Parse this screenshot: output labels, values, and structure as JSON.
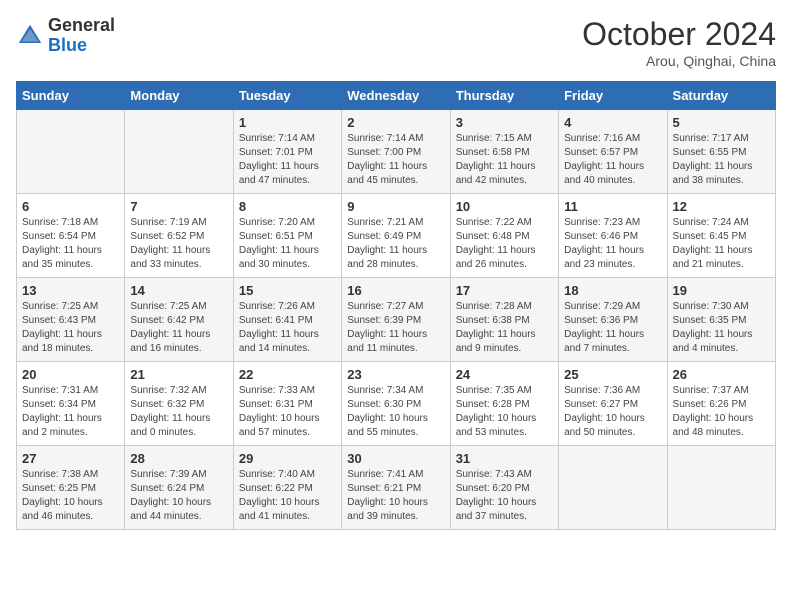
{
  "logo": {
    "general": "General",
    "blue": "Blue"
  },
  "header": {
    "month": "October 2024",
    "location": "Arou, Qinghai, China"
  },
  "days_of_week": [
    "Sunday",
    "Monday",
    "Tuesday",
    "Wednesday",
    "Thursday",
    "Friday",
    "Saturday"
  ],
  "weeks": [
    [
      {
        "day": "",
        "info": ""
      },
      {
        "day": "",
        "info": ""
      },
      {
        "day": "1",
        "info": "Sunrise: 7:14 AM\nSunset: 7:01 PM\nDaylight: 11 hours and 47 minutes."
      },
      {
        "day": "2",
        "info": "Sunrise: 7:14 AM\nSunset: 7:00 PM\nDaylight: 11 hours and 45 minutes."
      },
      {
        "day": "3",
        "info": "Sunrise: 7:15 AM\nSunset: 6:58 PM\nDaylight: 11 hours and 42 minutes."
      },
      {
        "day": "4",
        "info": "Sunrise: 7:16 AM\nSunset: 6:57 PM\nDaylight: 11 hours and 40 minutes."
      },
      {
        "day": "5",
        "info": "Sunrise: 7:17 AM\nSunset: 6:55 PM\nDaylight: 11 hours and 38 minutes."
      }
    ],
    [
      {
        "day": "6",
        "info": "Sunrise: 7:18 AM\nSunset: 6:54 PM\nDaylight: 11 hours and 35 minutes."
      },
      {
        "day": "7",
        "info": "Sunrise: 7:19 AM\nSunset: 6:52 PM\nDaylight: 11 hours and 33 minutes."
      },
      {
        "day": "8",
        "info": "Sunrise: 7:20 AM\nSunset: 6:51 PM\nDaylight: 11 hours and 30 minutes."
      },
      {
        "day": "9",
        "info": "Sunrise: 7:21 AM\nSunset: 6:49 PM\nDaylight: 11 hours and 28 minutes."
      },
      {
        "day": "10",
        "info": "Sunrise: 7:22 AM\nSunset: 6:48 PM\nDaylight: 11 hours and 26 minutes."
      },
      {
        "day": "11",
        "info": "Sunrise: 7:23 AM\nSunset: 6:46 PM\nDaylight: 11 hours and 23 minutes."
      },
      {
        "day": "12",
        "info": "Sunrise: 7:24 AM\nSunset: 6:45 PM\nDaylight: 11 hours and 21 minutes."
      }
    ],
    [
      {
        "day": "13",
        "info": "Sunrise: 7:25 AM\nSunset: 6:43 PM\nDaylight: 11 hours and 18 minutes."
      },
      {
        "day": "14",
        "info": "Sunrise: 7:25 AM\nSunset: 6:42 PM\nDaylight: 11 hours and 16 minutes."
      },
      {
        "day": "15",
        "info": "Sunrise: 7:26 AM\nSunset: 6:41 PM\nDaylight: 11 hours and 14 minutes."
      },
      {
        "day": "16",
        "info": "Sunrise: 7:27 AM\nSunset: 6:39 PM\nDaylight: 11 hours and 11 minutes."
      },
      {
        "day": "17",
        "info": "Sunrise: 7:28 AM\nSunset: 6:38 PM\nDaylight: 11 hours and 9 minutes."
      },
      {
        "day": "18",
        "info": "Sunrise: 7:29 AM\nSunset: 6:36 PM\nDaylight: 11 hours and 7 minutes."
      },
      {
        "day": "19",
        "info": "Sunrise: 7:30 AM\nSunset: 6:35 PM\nDaylight: 11 hours and 4 minutes."
      }
    ],
    [
      {
        "day": "20",
        "info": "Sunrise: 7:31 AM\nSunset: 6:34 PM\nDaylight: 11 hours and 2 minutes."
      },
      {
        "day": "21",
        "info": "Sunrise: 7:32 AM\nSunset: 6:32 PM\nDaylight: 11 hours and 0 minutes."
      },
      {
        "day": "22",
        "info": "Sunrise: 7:33 AM\nSunset: 6:31 PM\nDaylight: 10 hours and 57 minutes."
      },
      {
        "day": "23",
        "info": "Sunrise: 7:34 AM\nSunset: 6:30 PM\nDaylight: 10 hours and 55 minutes."
      },
      {
        "day": "24",
        "info": "Sunrise: 7:35 AM\nSunset: 6:28 PM\nDaylight: 10 hours and 53 minutes."
      },
      {
        "day": "25",
        "info": "Sunrise: 7:36 AM\nSunset: 6:27 PM\nDaylight: 10 hours and 50 minutes."
      },
      {
        "day": "26",
        "info": "Sunrise: 7:37 AM\nSunset: 6:26 PM\nDaylight: 10 hours and 48 minutes."
      }
    ],
    [
      {
        "day": "27",
        "info": "Sunrise: 7:38 AM\nSunset: 6:25 PM\nDaylight: 10 hours and 46 minutes."
      },
      {
        "day": "28",
        "info": "Sunrise: 7:39 AM\nSunset: 6:24 PM\nDaylight: 10 hours and 44 minutes."
      },
      {
        "day": "29",
        "info": "Sunrise: 7:40 AM\nSunset: 6:22 PM\nDaylight: 10 hours and 41 minutes."
      },
      {
        "day": "30",
        "info": "Sunrise: 7:41 AM\nSunset: 6:21 PM\nDaylight: 10 hours and 39 minutes."
      },
      {
        "day": "31",
        "info": "Sunrise: 7:43 AM\nSunset: 6:20 PM\nDaylight: 10 hours and 37 minutes."
      },
      {
        "day": "",
        "info": ""
      },
      {
        "day": "",
        "info": ""
      }
    ]
  ]
}
